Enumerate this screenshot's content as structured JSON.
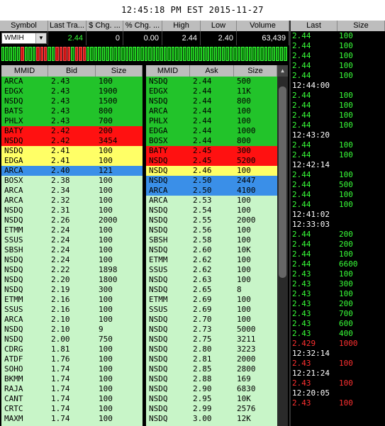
{
  "timestamp": "12:45:18 PM EST 2015-11-27",
  "quote_headers": [
    "Symbol",
    "Last Tra...",
    "$ Chg. ...",
    "% Chg. ...",
    "High",
    "Low",
    "Volume"
  ],
  "quote": {
    "symbol": "WMIH",
    "last": "2.44",
    "chg": "0",
    "pct": "0.00",
    "high": "2.44",
    "low": "2.40",
    "volume": "63,439"
  },
  "tick_bar": [
    "g",
    "g",
    "g",
    "g",
    "g",
    "r",
    "g",
    "g",
    "g",
    "r",
    "r",
    "r",
    "g",
    "g",
    "r",
    "r",
    "r",
    "r",
    "g",
    "r",
    "r",
    "r",
    "g",
    "g",
    "g",
    "g",
    "g",
    "g",
    "g",
    "g",
    "g",
    "g",
    "g",
    "g",
    "g",
    "g",
    "g",
    "g",
    "g",
    "g",
    "g",
    "g",
    "g",
    "g",
    "g",
    "g",
    "g",
    "g",
    "g",
    "g",
    "g",
    "g",
    "g",
    "g",
    "g",
    "g",
    "g",
    "g",
    "g",
    "g",
    "g",
    "g",
    "g",
    "g",
    "g",
    "g",
    "g",
    "g",
    "g",
    "g",
    "g",
    "g",
    "g",
    "g"
  ],
  "bid_headers": [
    "MMID",
    "Bid",
    "Size"
  ],
  "ask_headers": [
    "MMID",
    "Ask",
    "Size"
  ],
  "colors": {
    "green": "#22c32a",
    "red": "#ff1111",
    "yellow": "#ffff66",
    "blue": "#3a8fe8",
    "light": "#c8f5c8"
  },
  "bids": [
    [
      "ARCA",
      "2.43",
      "100",
      "green"
    ],
    [
      "EDGX",
      "2.43",
      "1900",
      "green"
    ],
    [
      "NSDQ",
      "2.43",
      "1500",
      "green"
    ],
    [
      "BATS",
      "2.43",
      "800",
      "green"
    ],
    [
      "PHLX",
      "2.43",
      "700",
      "green"
    ],
    [
      "BATY",
      "2.42",
      "200",
      "red"
    ],
    [
      "NSDQ",
      "2.42",
      "3454",
      "red"
    ],
    [
      "NSDQ",
      "2.41",
      "100",
      "yellow"
    ],
    [
      "EDGA",
      "2.41",
      "100",
      "yellow"
    ],
    [
      "ARCA",
      "2.40",
      "121",
      "blue"
    ],
    [
      "BOSX",
      "2.38",
      "100",
      "light"
    ],
    [
      "ARCA",
      "2.34",
      "100",
      "light"
    ],
    [
      "ARCA",
      "2.32",
      "100",
      "light"
    ],
    [
      "NSDQ",
      "2.31",
      "100",
      "light"
    ],
    [
      "NSDQ",
      "2.26",
      "2000",
      "light"
    ],
    [
      "ETMM",
      "2.24",
      "100",
      "light"
    ],
    [
      "SSUS",
      "2.24",
      "100",
      "light"
    ],
    [
      "SBSH",
      "2.24",
      "100",
      "light"
    ],
    [
      "NSDQ",
      "2.24",
      "100",
      "light"
    ],
    [
      "NSDQ",
      "2.22",
      "1898",
      "light"
    ],
    [
      "NSDQ",
      "2.20",
      "1800",
      "light"
    ],
    [
      "NSDQ",
      "2.19",
      "300",
      "light"
    ],
    [
      "ETMM",
      "2.16",
      "100",
      "light"
    ],
    [
      "SSUS",
      "2.16",
      "100",
      "light"
    ],
    [
      "ARCA",
      "2.10",
      "100",
      "light"
    ],
    [
      "NSDQ",
      "2.10",
      "9",
      "light"
    ],
    [
      "NSDQ",
      "2.00",
      "750",
      "light"
    ],
    [
      "CDRG",
      "1.81",
      "100",
      "light"
    ],
    [
      "ATDF",
      "1.76",
      "100",
      "light"
    ],
    [
      "SOHO",
      "1.74",
      "100",
      "light"
    ],
    [
      "BKMM",
      "1.74",
      "100",
      "light"
    ],
    [
      "RAJA",
      "1.74",
      "100",
      "light"
    ],
    [
      "CANT",
      "1.74",
      "100",
      "light"
    ],
    [
      "CRTC",
      "1.74",
      "100",
      "light"
    ],
    [
      "MAXM",
      "1.74",
      "100",
      "light"
    ]
  ],
  "asks": [
    [
      "NSDQ",
      "2.44",
      "500",
      "green"
    ],
    [
      "EDGX",
      "2.44",
      "11K",
      "green"
    ],
    [
      "NSDQ",
      "2.44",
      "800",
      "green"
    ],
    [
      "ARCA",
      "2.44",
      "100",
      "green"
    ],
    [
      "PHLX",
      "2.44",
      "100",
      "green"
    ],
    [
      "EDGA",
      "2.44",
      "1000",
      "green"
    ],
    [
      "BOSX",
      "2.44",
      "800",
      "green"
    ],
    [
      "BATY",
      "2.45",
      "300",
      "red"
    ],
    [
      "NSDQ",
      "2.45",
      "5200",
      "red"
    ],
    [
      "NSDQ",
      "2.46",
      "100",
      "yellow"
    ],
    [
      "NSDQ",
      "2.50",
      "2447",
      "blue"
    ],
    [
      "ARCA",
      "2.50",
      "4100",
      "blue"
    ],
    [
      "ARCA",
      "2.53",
      "100",
      "light"
    ],
    [
      "NSDQ",
      "2.54",
      "100",
      "light"
    ],
    [
      "NSDQ",
      "2.55",
      "2000",
      "light"
    ],
    [
      "NSDQ",
      "2.56",
      "100",
      "light"
    ],
    [
      "SBSH",
      "2.58",
      "100",
      "light"
    ],
    [
      "NSDQ",
      "2.60",
      "10K",
      "light"
    ],
    [
      "ETMM",
      "2.62",
      "100",
      "light"
    ],
    [
      "SSUS",
      "2.62",
      "100",
      "light"
    ],
    [
      "NSDQ",
      "2.63",
      "100",
      "light"
    ],
    [
      "NSDQ",
      "2.65",
      "8",
      "light"
    ],
    [
      "ETMM",
      "2.69",
      "100",
      "light"
    ],
    [
      "SSUS",
      "2.69",
      "100",
      "light"
    ],
    [
      "NSDQ",
      "2.70",
      "100",
      "light"
    ],
    [
      "NSDQ",
      "2.73",
      "5000",
      "light"
    ],
    [
      "NSDQ",
      "2.75",
      "3211",
      "light"
    ],
    [
      "NSDQ",
      "2.80",
      "3223",
      "light"
    ],
    [
      "NSDQ",
      "2.81",
      "2000",
      "light"
    ],
    [
      "NSDQ",
      "2.85",
      "2800",
      "light"
    ],
    [
      "NSDQ",
      "2.88",
      "169",
      "light"
    ],
    [
      "NSDQ",
      "2.90",
      "6830",
      "light"
    ],
    [
      "NSDQ",
      "2.95",
      "10K",
      "light"
    ],
    [
      "NSDQ",
      "2.99",
      "2576",
      "light"
    ],
    [
      "NSDQ",
      "3.00",
      "12K",
      "light"
    ]
  ],
  "ts_headers": [
    "Last",
    "Size"
  ],
  "time_sales": [
    [
      "2.44",
      "100",
      "g"
    ],
    [
      "2.44",
      "100",
      "g"
    ],
    [
      "2.44",
      "100",
      "g"
    ],
    [
      "2.44",
      "100",
      "g"
    ],
    [
      "2.44",
      "100",
      "g"
    ],
    [
      "12:44:00",
      "",
      "t"
    ],
    [
      "2.44",
      "100",
      "g"
    ],
    [
      "2.44",
      "100",
      "g"
    ],
    [
      "2.44",
      "100",
      "g"
    ],
    [
      "2.44",
      "100",
      "g"
    ],
    [
      "12:43:20",
      "",
      "t"
    ],
    [
      "2.44",
      "100",
      "g"
    ],
    [
      "2.44",
      "100",
      "g"
    ],
    [
      "12:42:14",
      "",
      "t"
    ],
    [
      "2.44",
      "100",
      "g"
    ],
    [
      "2.44",
      "500",
      "g"
    ],
    [
      "2.44",
      "100",
      "g"
    ],
    [
      "2.44",
      "100",
      "g"
    ],
    [
      "12:41:02",
      "",
      "t"
    ],
    [
      "12:33:03",
      "",
      "t"
    ],
    [
      "2.44",
      "200",
      "g"
    ],
    [
      "2.44",
      "200",
      "g"
    ],
    [
      "2.44",
      "100",
      "g"
    ],
    [
      "2.44",
      "6600",
      "g"
    ],
    [
      "2.43",
      "100",
      "g"
    ],
    [
      "2.43",
      "300",
      "g"
    ],
    [
      "2.43",
      "100",
      "g"
    ],
    [
      "2.43",
      "200",
      "g"
    ],
    [
      "2.43",
      "700",
      "g"
    ],
    [
      "2.43",
      "600",
      "g"
    ],
    [
      "2.43",
      "400",
      "g"
    ],
    [
      "2.429",
      "1000",
      "r"
    ],
    [
      "12:32:14",
      "",
      "t"
    ],
    [
      "2.43",
      "100",
      "r"
    ],
    [
      "12:21:24",
      "",
      "t"
    ],
    [
      "2.43",
      "100",
      "r"
    ],
    [
      "12:20:05",
      "",
      "t"
    ],
    [
      "2.43",
      "100",
      "r"
    ]
  ]
}
